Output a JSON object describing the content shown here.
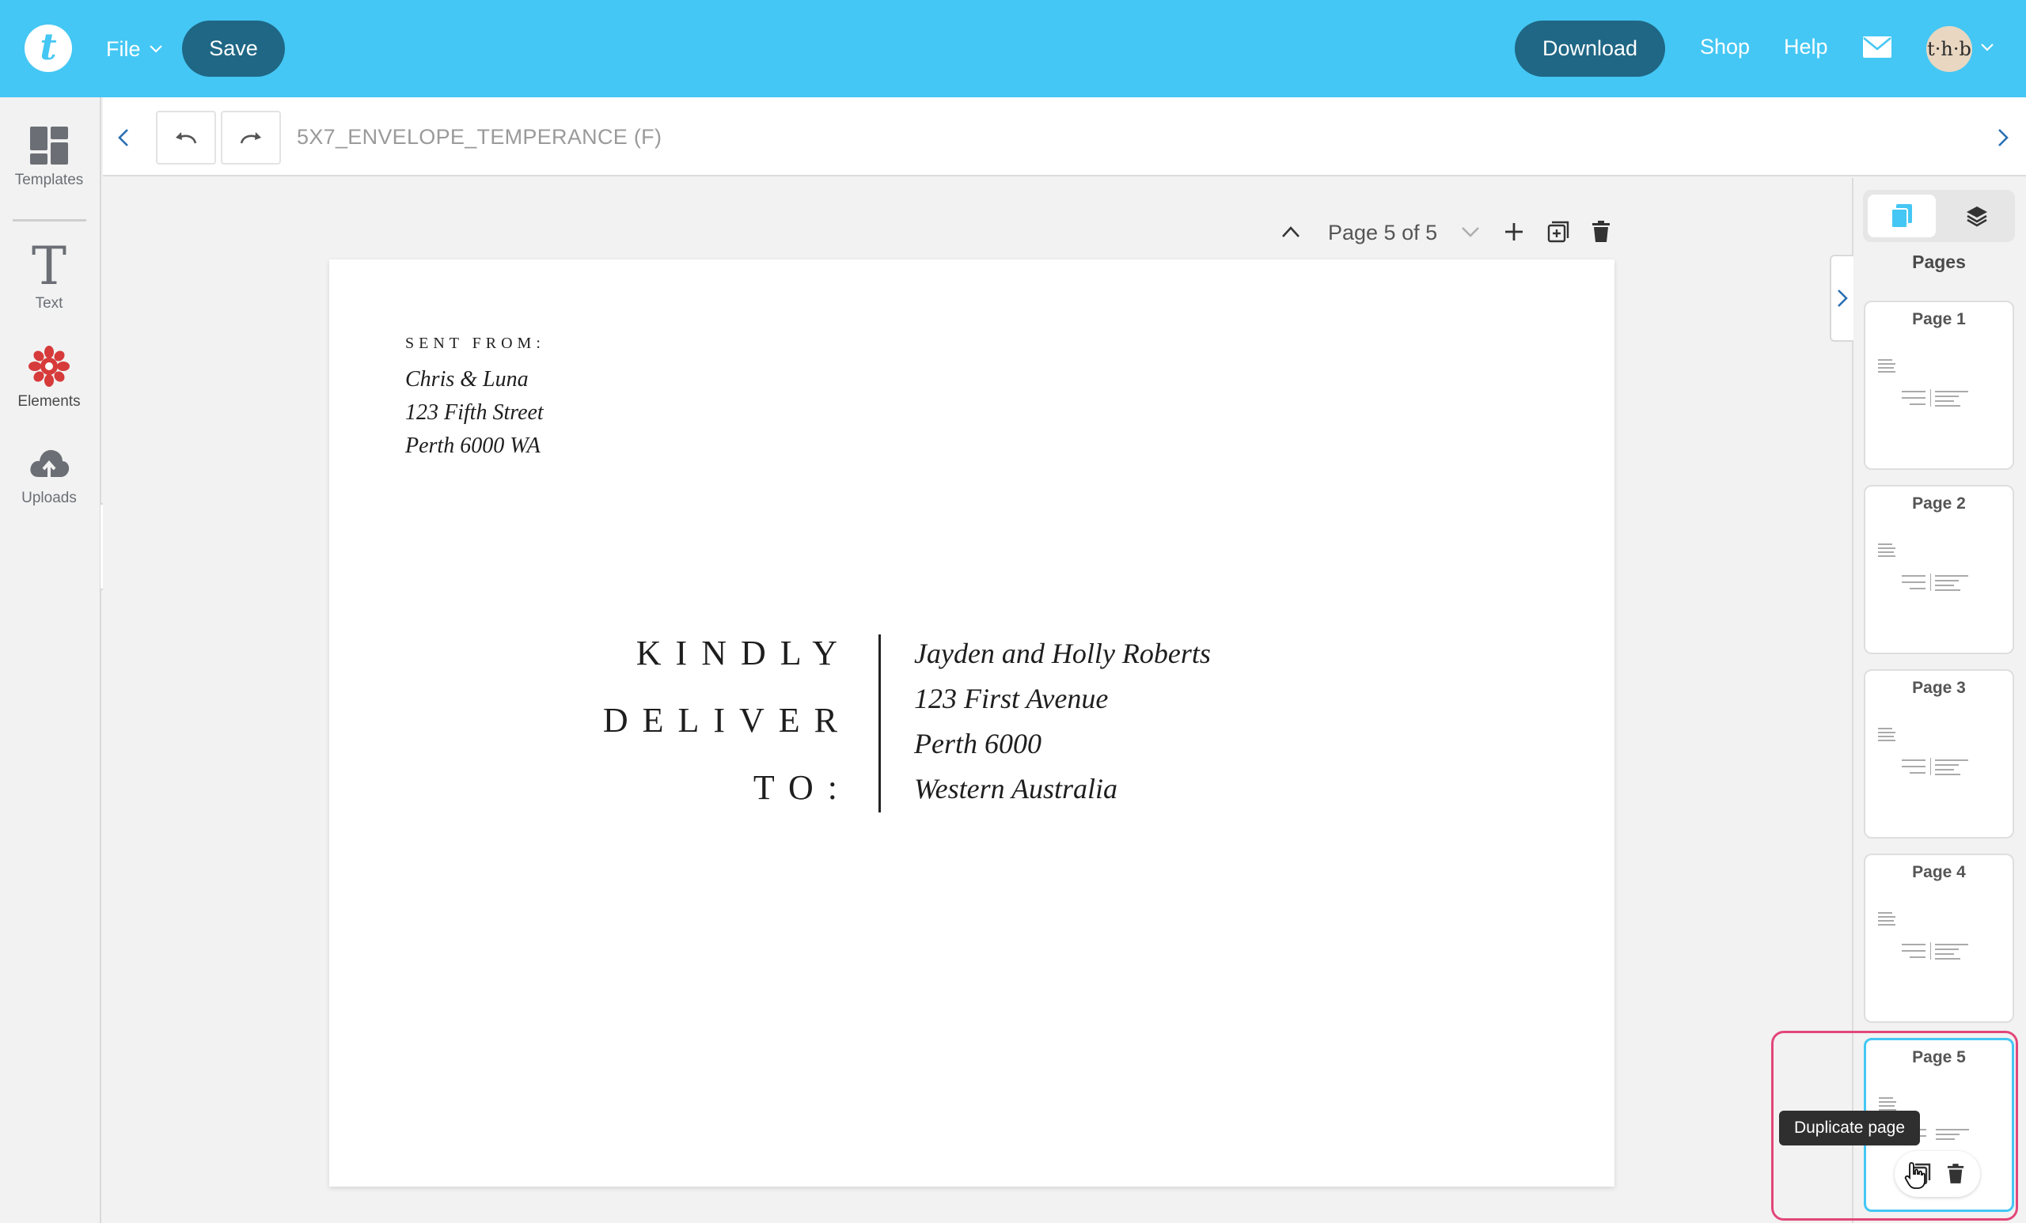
{
  "topbar": {
    "logo_letter": "t",
    "file_label": "File",
    "save_label": "Save",
    "download_label": "Download",
    "shop_label": "Shop",
    "help_label": "Help",
    "avatar_text": "t·h·b",
    "accent_color": "#44c7f4",
    "button_color": "#1f6785"
  },
  "rail": {
    "items": [
      {
        "label": "Templates",
        "icon": "templates-grid-icon"
      },
      {
        "label": "Text",
        "icon": "text-T-icon"
      },
      {
        "label": "Elements",
        "icon": "elements-flower-icon"
      },
      {
        "label": "Uploads",
        "icon": "upload-cloud-icon"
      }
    ]
  },
  "toolbar": {
    "doc_title": "5X7_ENVELOPE_TEMPERANCE (F)"
  },
  "page_nav": {
    "label": "Page 5 of 5"
  },
  "envelope": {
    "sent_from_heading": "SENT FROM:",
    "sender_lines": [
      "Chris & Luna",
      "123 Fifth Street",
      "Perth 6000 WA"
    ],
    "deliver_lines": [
      "KINDLY",
      "DELIVER",
      "TO:"
    ],
    "recipient_lines": [
      "Jayden and Holly Roberts",
      "123 First Avenue",
      "Perth 6000",
      "Western Australia"
    ]
  },
  "pages_panel": {
    "title": "Pages",
    "pages": [
      "Page 1",
      "Page 2",
      "Page 3",
      "Page 4",
      "Page 5"
    ],
    "active_page": 5,
    "tooltip": "Duplicate page",
    "highlight_color": "#e2477a"
  }
}
